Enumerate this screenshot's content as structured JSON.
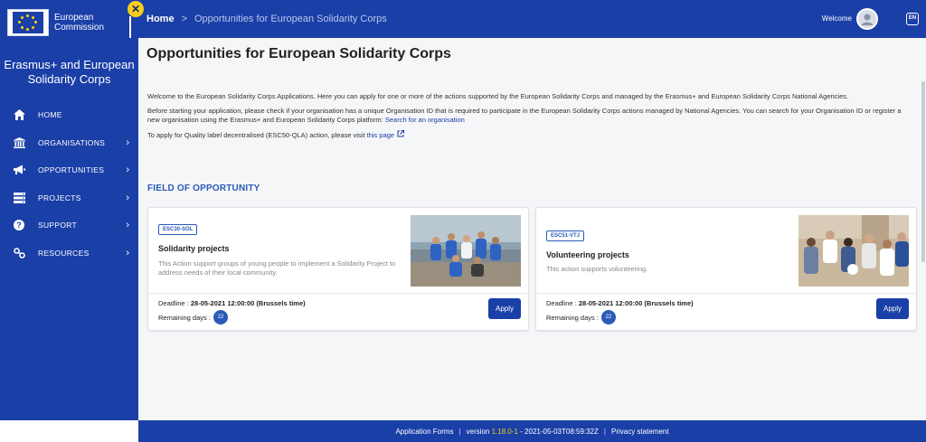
{
  "logo": {
    "line1": "European",
    "line2": "Commission"
  },
  "sidebar": {
    "title": "Erasmus+ and European Solidarity Corps",
    "items": [
      {
        "label": "HOME",
        "icon": "home-icon",
        "chevron": false
      },
      {
        "label": "ORGANISATIONS",
        "icon": "bank-icon",
        "chevron": true
      },
      {
        "label": "OPPORTUNITIES",
        "icon": "megaphone-icon",
        "chevron": true
      },
      {
        "label": "PROJECTS",
        "icon": "server-icon",
        "chevron": true
      },
      {
        "label": "SUPPORT",
        "icon": "help-icon",
        "chevron": true
      },
      {
        "label": "RESOURCES",
        "icon": "link-icon",
        "chevron": true
      }
    ]
  },
  "header": {
    "home": "Home",
    "separator": ">",
    "current": "Opportunities for European Solidarity Corps",
    "welcome": "Welcome",
    "lang": "EN"
  },
  "main": {
    "title": "Opportunities for European Solidarity Corps",
    "intro1": "Welcome to the European Solidarity Corps Applications. Here you can apply for one or more of the actions supported by the European Solidarity Corps and managed by the Erasmus+ and European Solidarity Corps National Agencies.",
    "intro2": "Before starting your application, please check if your organisation has a unique Organisation ID that is required to participate in the European Solidarity Corps actions managed by National Agencies. You can search for your Organisation ID or register a new organisation using the Erasmus+ and European Solidarity Corps platform:",
    "intro2_link": "Search for an organisation",
    "intro3": "To apply for Quality label decentralised (ESC50-QLA) action, please visit",
    "intro3_link": "this page",
    "section_title": "FIELD OF OPPORTUNITY"
  },
  "cards": [
    {
      "tag": "ESC30-SOL",
      "title": "Solidarity projects",
      "desc": "This Action support groups of young people to implement a Solidarity Project to address needs of their local community.",
      "deadline_label": "Deadline :",
      "deadline_value": "28-05-2021 12:00:00 (Brussels time)",
      "remaining_label": "Remaining days :",
      "remaining_days": "22",
      "apply": "Apply"
    },
    {
      "tag": "ESC51-VTJ",
      "title": "Volunteering projects",
      "desc": "This action supports volunteering.",
      "deadline_label": "Deadline :",
      "deadline_value": "28-05-2021 12:00:00 (Brussels time)",
      "remaining_label": "Remaining days :",
      "remaining_days": "22",
      "apply": "Apply"
    }
  ],
  "footer": {
    "app": "Application Forms",
    "sep": "|",
    "version_label": "version",
    "version": "1.18.0-1",
    "build": "- 2021-05-03T08:59:32Z",
    "privacy": "Privacy statement"
  },
  "colors": {
    "brand": "#1a3fa7",
    "accent": "#2a5bb7",
    "badge": "#f5cf1c"
  }
}
